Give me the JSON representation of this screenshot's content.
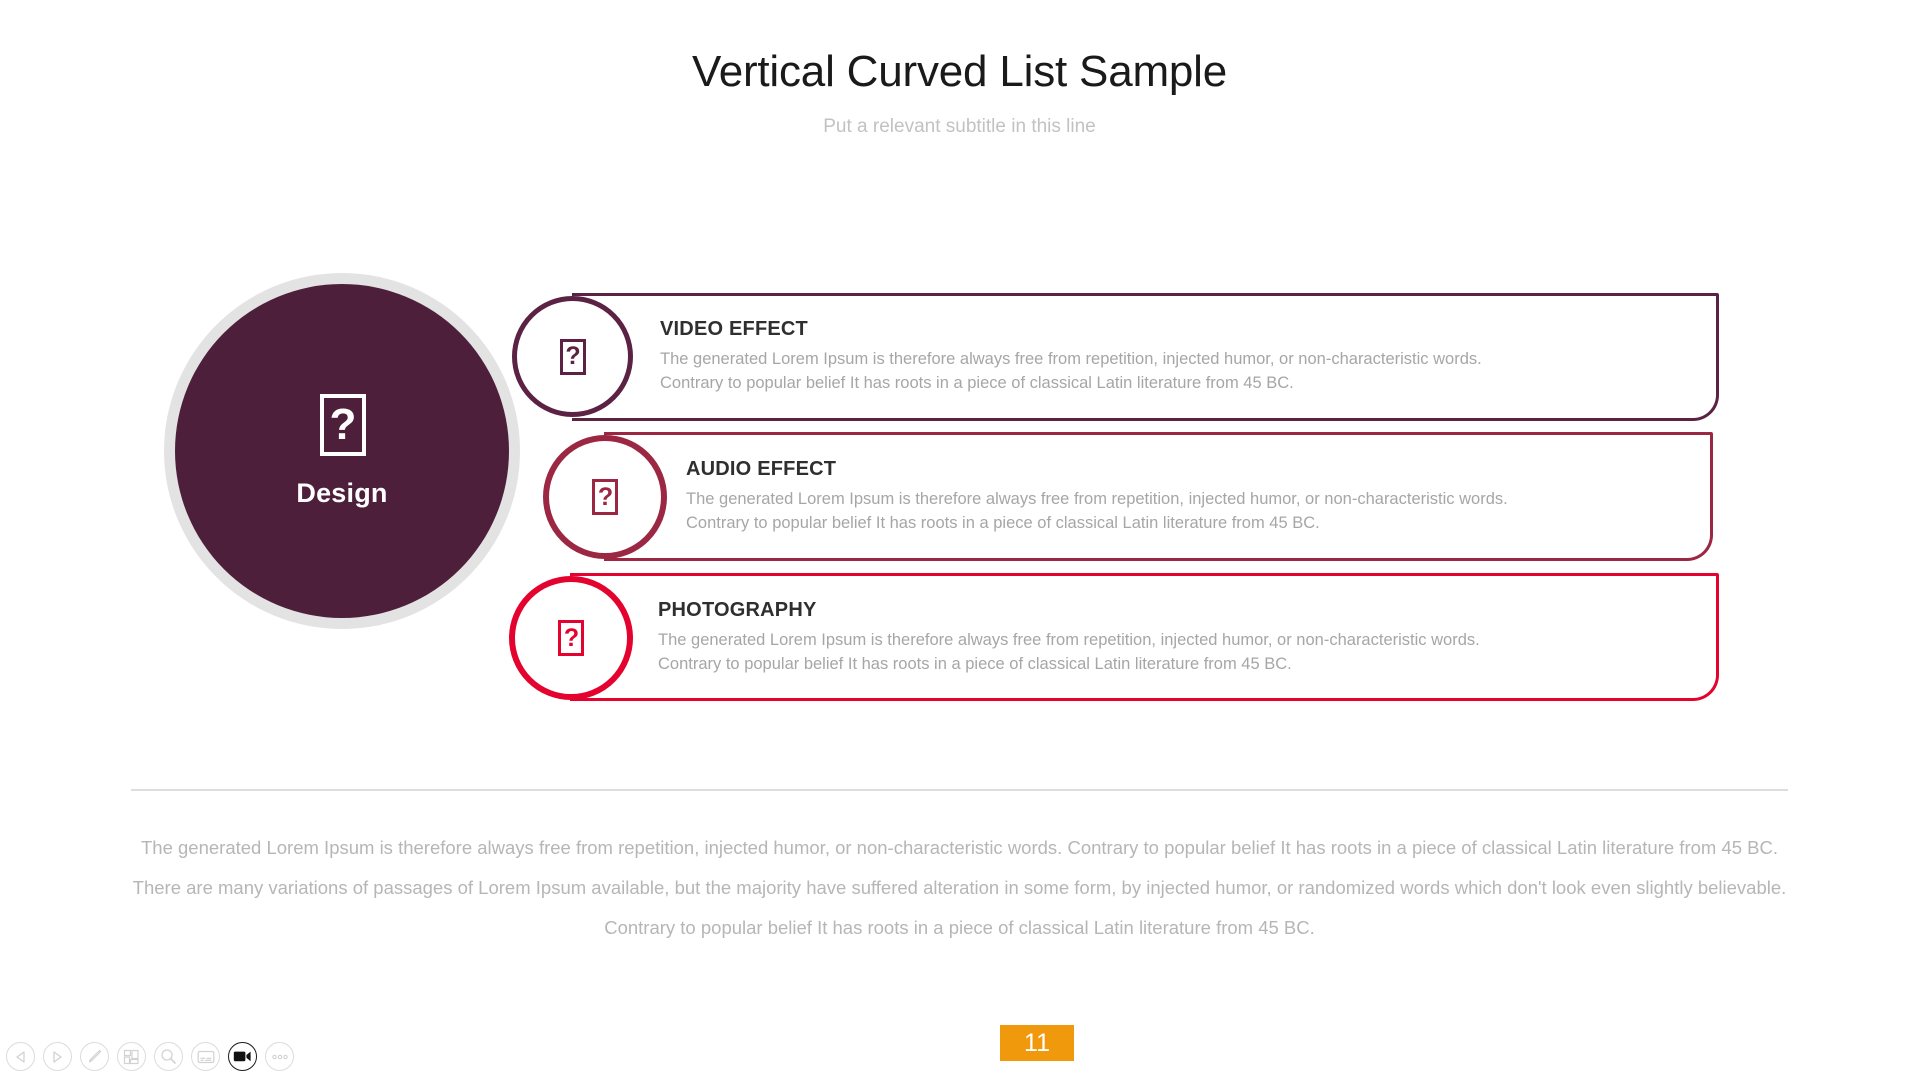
{
  "slide": {
    "title": "Vertical Curved List Sample",
    "subtitle": "Put a relevant subtitle in this line"
  },
  "hub": {
    "label": "Design",
    "icon": "missing-glyph-question-box",
    "icon_glyph": "?",
    "fill_color": "#4d1f3b",
    "ring_color": "#e3e3e3"
  },
  "rows": [
    {
      "title": "VIDEO EFFECT",
      "desc_line1": "The generated Lorem Ipsum is therefore always free from repetition, injected humor, or non-characteristic words.",
      "desc_line2": "Contrary to popular belief It has roots in a piece of classical Latin literature from 45 BC.",
      "icon": "missing-glyph-question-box",
      "icon_glyph": "?",
      "accent_color": "#5c2244"
    },
    {
      "title": "AUDIO EFFECT",
      "desc_line1": "The generated Lorem Ipsum is therefore always free from repetition, injected humor, or non-characteristic words.",
      "desc_line2": "Contrary to popular belief It has roots in a piece of classical Latin literature from 45 BC.",
      "icon": "missing-glyph-question-box",
      "icon_glyph": "?",
      "accent_color": "#9b2743"
    },
    {
      "title": "PHOTOGRAPHY",
      "desc_line1": "The generated Lorem Ipsum is therefore always free from repetition, injected humor, or non-characteristic words.",
      "desc_line2": "Contrary to popular belief It has roots in a piece of classical Latin literature from 45 BC.",
      "icon": "missing-glyph-question-box",
      "icon_glyph": "?",
      "accent_color": "#e4032e"
    }
  ],
  "footer": {
    "paragraph": "The generated Lorem Ipsum is therefore always free from repetition, injected humor, or non-characteristic words. Contrary to popular belief It has roots in a piece of classical Latin literature from 45 BC. There are many variations of passages of Lorem Ipsum available, but the majority have suffered alteration in some form, by injected humor, or randomized words which don't look even slightly believable. Contrary to popular belief It has roots in a piece of classical Latin literature from 45 BC."
  },
  "toolbar": {
    "buttons": [
      {
        "name": "previous-slide",
        "icon": "triangle-left-icon",
        "active": false
      },
      {
        "name": "next-slide",
        "icon": "triangle-right-icon",
        "active": false
      },
      {
        "name": "pen-tool",
        "icon": "pen-icon",
        "active": false
      },
      {
        "name": "slide-overview",
        "icon": "grid-slides-icon",
        "active": false
      },
      {
        "name": "zoom-tool",
        "icon": "magnifier-icon",
        "active": false
      },
      {
        "name": "captions",
        "icon": "caption-screen-icon",
        "active": false
      },
      {
        "name": "presenter-video",
        "icon": "video-camera-icon",
        "active": true
      },
      {
        "name": "more-options",
        "icon": "ellipsis-icon",
        "active": false
      }
    ]
  },
  "page_badge": {
    "number": "11",
    "background_color": "#f0990d",
    "text_color": "#ffffff"
  }
}
